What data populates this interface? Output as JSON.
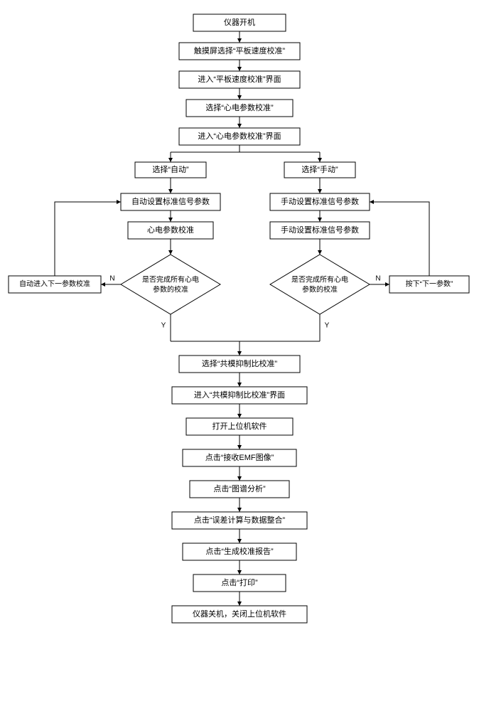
{
  "nodes": {
    "n1": "仪器开机",
    "n2": "触摸屏选择“平板速度校准”",
    "n3": "进入“平板速度校准”界面",
    "n4": "选择“心电参数校准”",
    "n5": "进入“心电参数校准”界面",
    "n6": "选择“自动”",
    "n7": "选择“手动”",
    "n8": "自动设置标准信号参数",
    "n9": "手动设置标准信号参数",
    "n10": "心电参数校准",
    "n11": "手动设置标准信号参数",
    "d1a": "是否完成所有心电",
    "d1b": "参数的校准",
    "d2a": "是否完成所有心电",
    "d2b": "参数的校准",
    "nL": "自动进入下一参数校准",
    "nR": "按下“下一参数”",
    "n12": "选择“共模抑制比校准”",
    "n13": "进入“共模抑制比校准”界面",
    "n14": "打开上位机软件",
    "n15": "点击“接收EMF图像”",
    "n16": "点击“图谱分析”",
    "n17": "点击“误差计算与数据整合”",
    "n18": "点击“生成校准报告”",
    "n19": "点击“打印”",
    "n20": "仪器关机，关闭上位机软件"
  },
  "edges": {
    "yes": "Y",
    "no": "N"
  }
}
